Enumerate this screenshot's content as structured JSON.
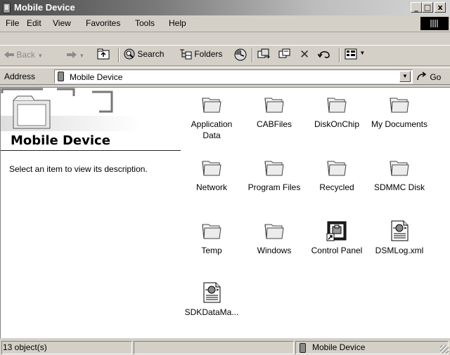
{
  "window": {
    "title": "Mobile Device",
    "controls": {
      "minimize": "_",
      "maximize": "□",
      "close": "x"
    }
  },
  "menu": [
    "File",
    "Edit",
    "View",
    "Favorites",
    "Tools",
    "Help"
  ],
  "toolbar": {
    "back": "Back",
    "search": "Search",
    "folders": "Folders"
  },
  "address": {
    "label": "Address",
    "value": "Mobile Device",
    "go": "Go"
  },
  "left_pane": {
    "heading": "Mobile Device",
    "description": "Select an item to view its description."
  },
  "items": [
    {
      "label": "Application Data",
      "icon": "folder-icon"
    },
    {
      "label": "CABFiles",
      "icon": "folder-icon"
    },
    {
      "label": "DiskOnChip",
      "icon": "folder-icon"
    },
    {
      "label": "My Documents",
      "icon": "folder-icon"
    },
    {
      "label": "Network",
      "icon": "folder-icon"
    },
    {
      "label": "Program Files",
      "icon": "folder-icon"
    },
    {
      "label": "Recycled",
      "icon": "folder-icon"
    },
    {
      "label": "SDMMC Disk",
      "icon": "folder-icon"
    },
    {
      "label": "Temp",
      "icon": "folder-icon"
    },
    {
      "label": "Windows",
      "icon": "folder-icon"
    },
    {
      "label": "Control Panel",
      "icon": "control-panel-shortcut-icon"
    },
    {
      "label": "DSMLog.xml",
      "icon": "xml-file-icon"
    },
    {
      "label": "SDKDataMa...",
      "icon": "xml-file-icon"
    }
  ],
  "status": {
    "count": "13 object(s)",
    "location": "Mobile Device"
  }
}
